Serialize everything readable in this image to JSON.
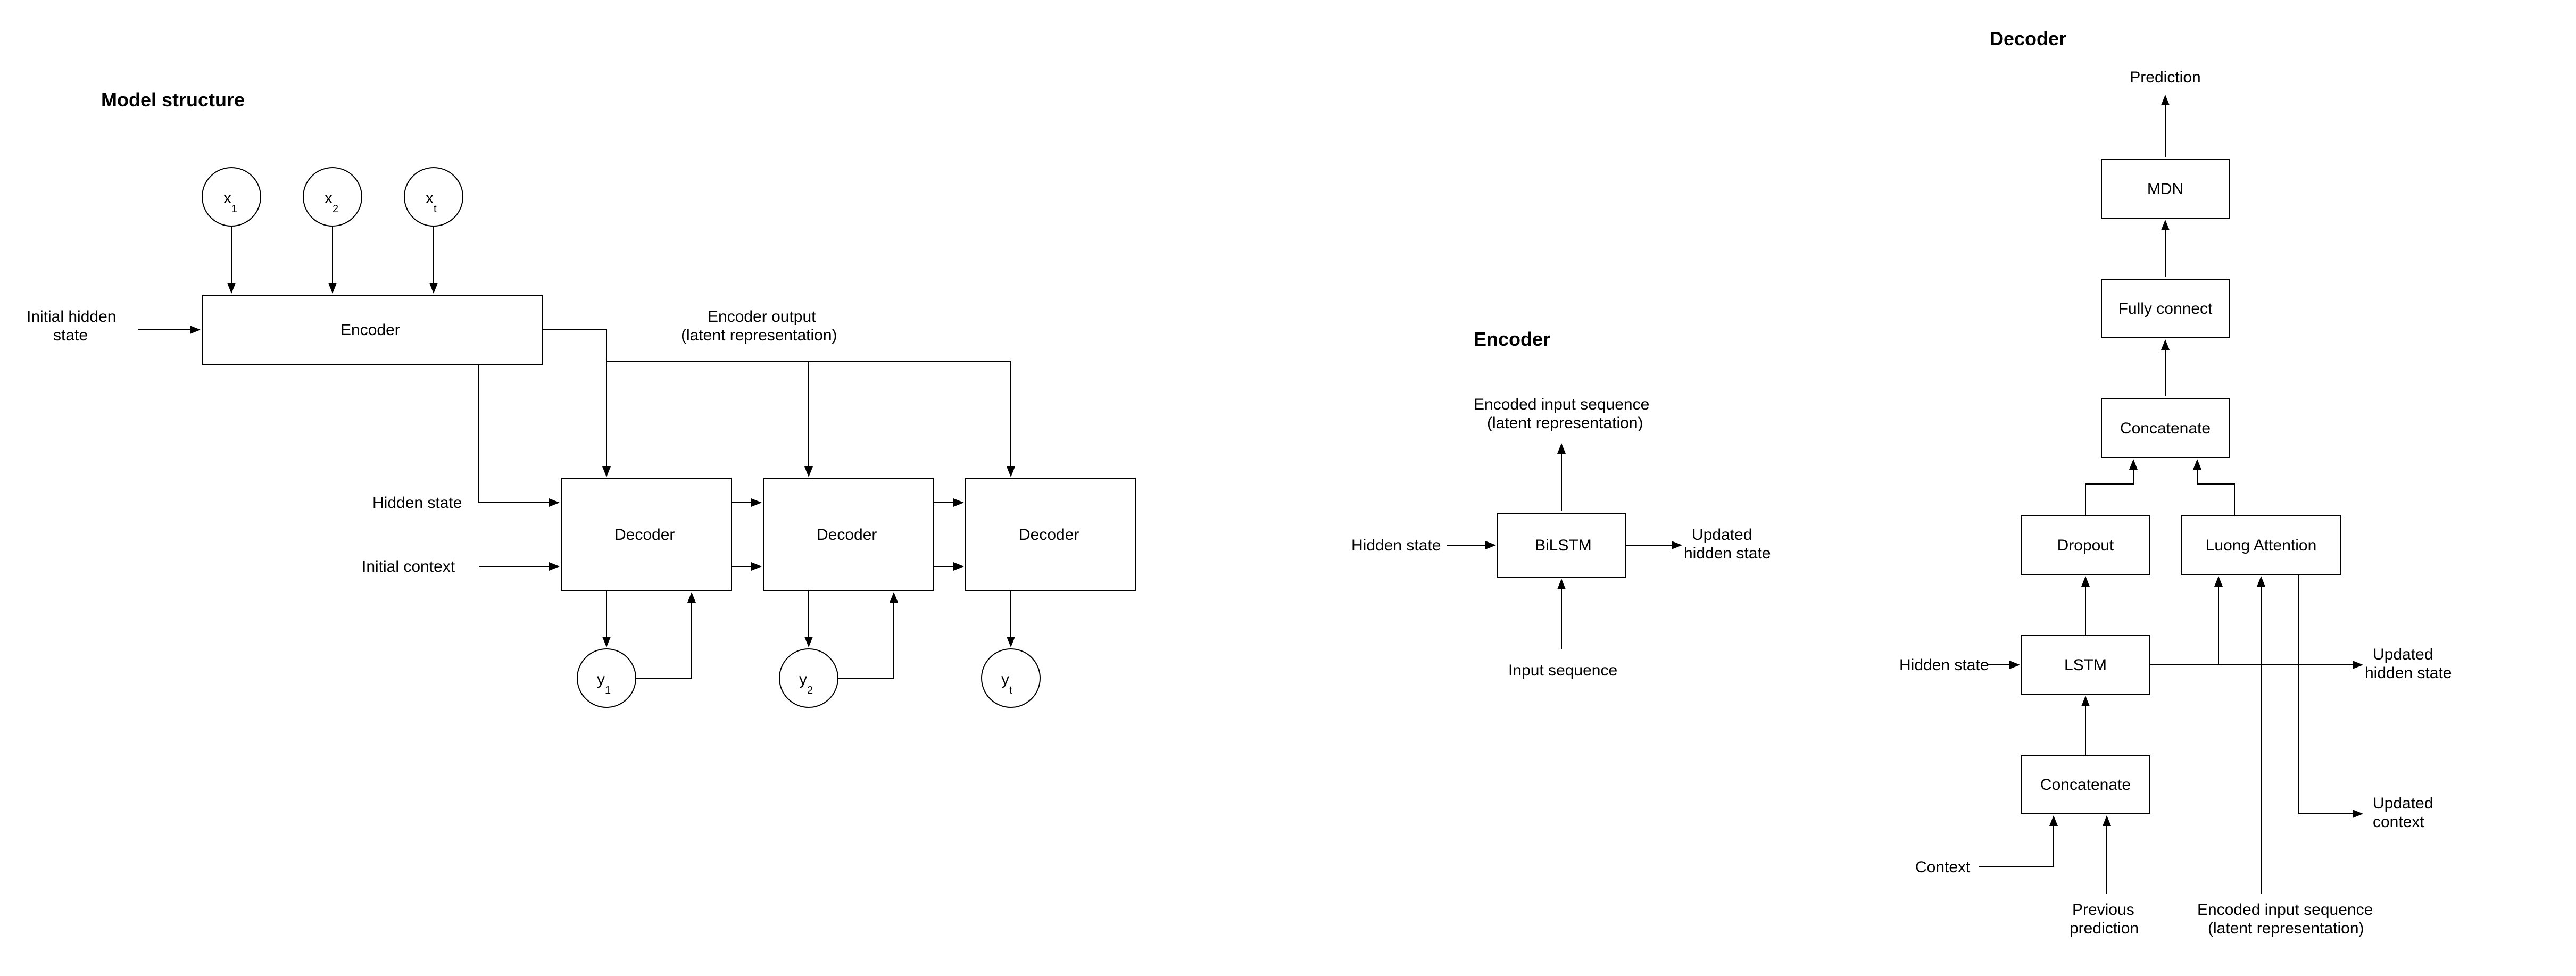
{
  "model_structure": {
    "title": "Model structure",
    "inputs": {
      "x1": "x",
      "x1_sub": "1",
      "x2": "x",
      "x2_sub": "2",
      "xt": "x",
      "xt_sub": "t"
    },
    "encoder": "Encoder",
    "initial_hidden": "Initial hidden\nstate",
    "encoder_output": "Encoder output\n(latent representation)",
    "hidden_state": "Hidden state",
    "initial_context": "Initial context",
    "decoder": "Decoder",
    "outputs": {
      "y1": "y",
      "y1_sub": "1",
      "y2": "y",
      "y2_sub": "2",
      "yt": "y",
      "yt_sub": "t"
    }
  },
  "encoder": {
    "title": "Encoder",
    "hidden_state": "Hidden state",
    "bilstm": "BiLSTM",
    "updated_hidden": "Updated\nhidden state",
    "encoded_seq": "Encoded input sequence\n(latent representation)",
    "input_seq": "Input sequence"
  },
  "decoder": {
    "title": "Decoder",
    "prediction": "Prediction",
    "mdn": "MDN",
    "fully_connect": "Fully connect",
    "concatenate": "Concatenate",
    "dropout": "Dropout",
    "luong": "Luong Attention",
    "lstm": "LSTM",
    "hidden_state": "Hidden state",
    "updated_hidden": "Updated\nhidden state",
    "updated_context": "Updated\ncontext",
    "context": "Context",
    "previous_pred": "Previous\nprediction",
    "encoded_seq": "Encoded input sequence\n(latent representation)"
  }
}
